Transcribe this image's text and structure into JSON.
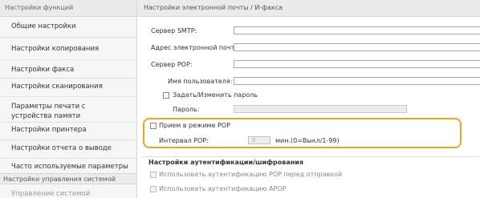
{
  "sidebar": {
    "header": "Настройки функций",
    "items": [
      {
        "label": "Общие настройки"
      },
      {
        "label": "Настройки копирования"
      },
      {
        "label": "Настройки факса"
      },
      {
        "label": "Настройки сканирования"
      },
      {
        "label": "Параметры печати с устройства памяти"
      },
      {
        "label": "Настройки принтера"
      },
      {
        "label": "Настройки отчета о выводе"
      },
      {
        "label": "Часто используемые параметры"
      }
    ],
    "group_label": "Настройки управления системой",
    "sub_item": "Управление системой"
  },
  "main": {
    "header": "Настройки электронной почты / И-факса",
    "smtp_server_label": "Сервер SMTP:",
    "email_address_label": "Адрес электронной почты:",
    "pop_server_label": "Сервер POP:",
    "username_label": "Имя пользователя:",
    "set_password_label": "Задать/Изменить пароль",
    "password_label": "Пароль:",
    "pop_receive_label": "Прием в режиме POP",
    "pop_interval_label": "Интервал POP:",
    "pop_interval_value": "0",
    "pop_interval_unit": "мин.(0=Выкл/1-99)",
    "auth_section_title": "Настройки аутентификации/шифрования",
    "pop_before_send_label": "Использовать аутентификацию POP перед отправкой",
    "apop_label": "Использовать аутентификацию APOP"
  },
  "colors": {
    "highlight": "#f0a325"
  }
}
